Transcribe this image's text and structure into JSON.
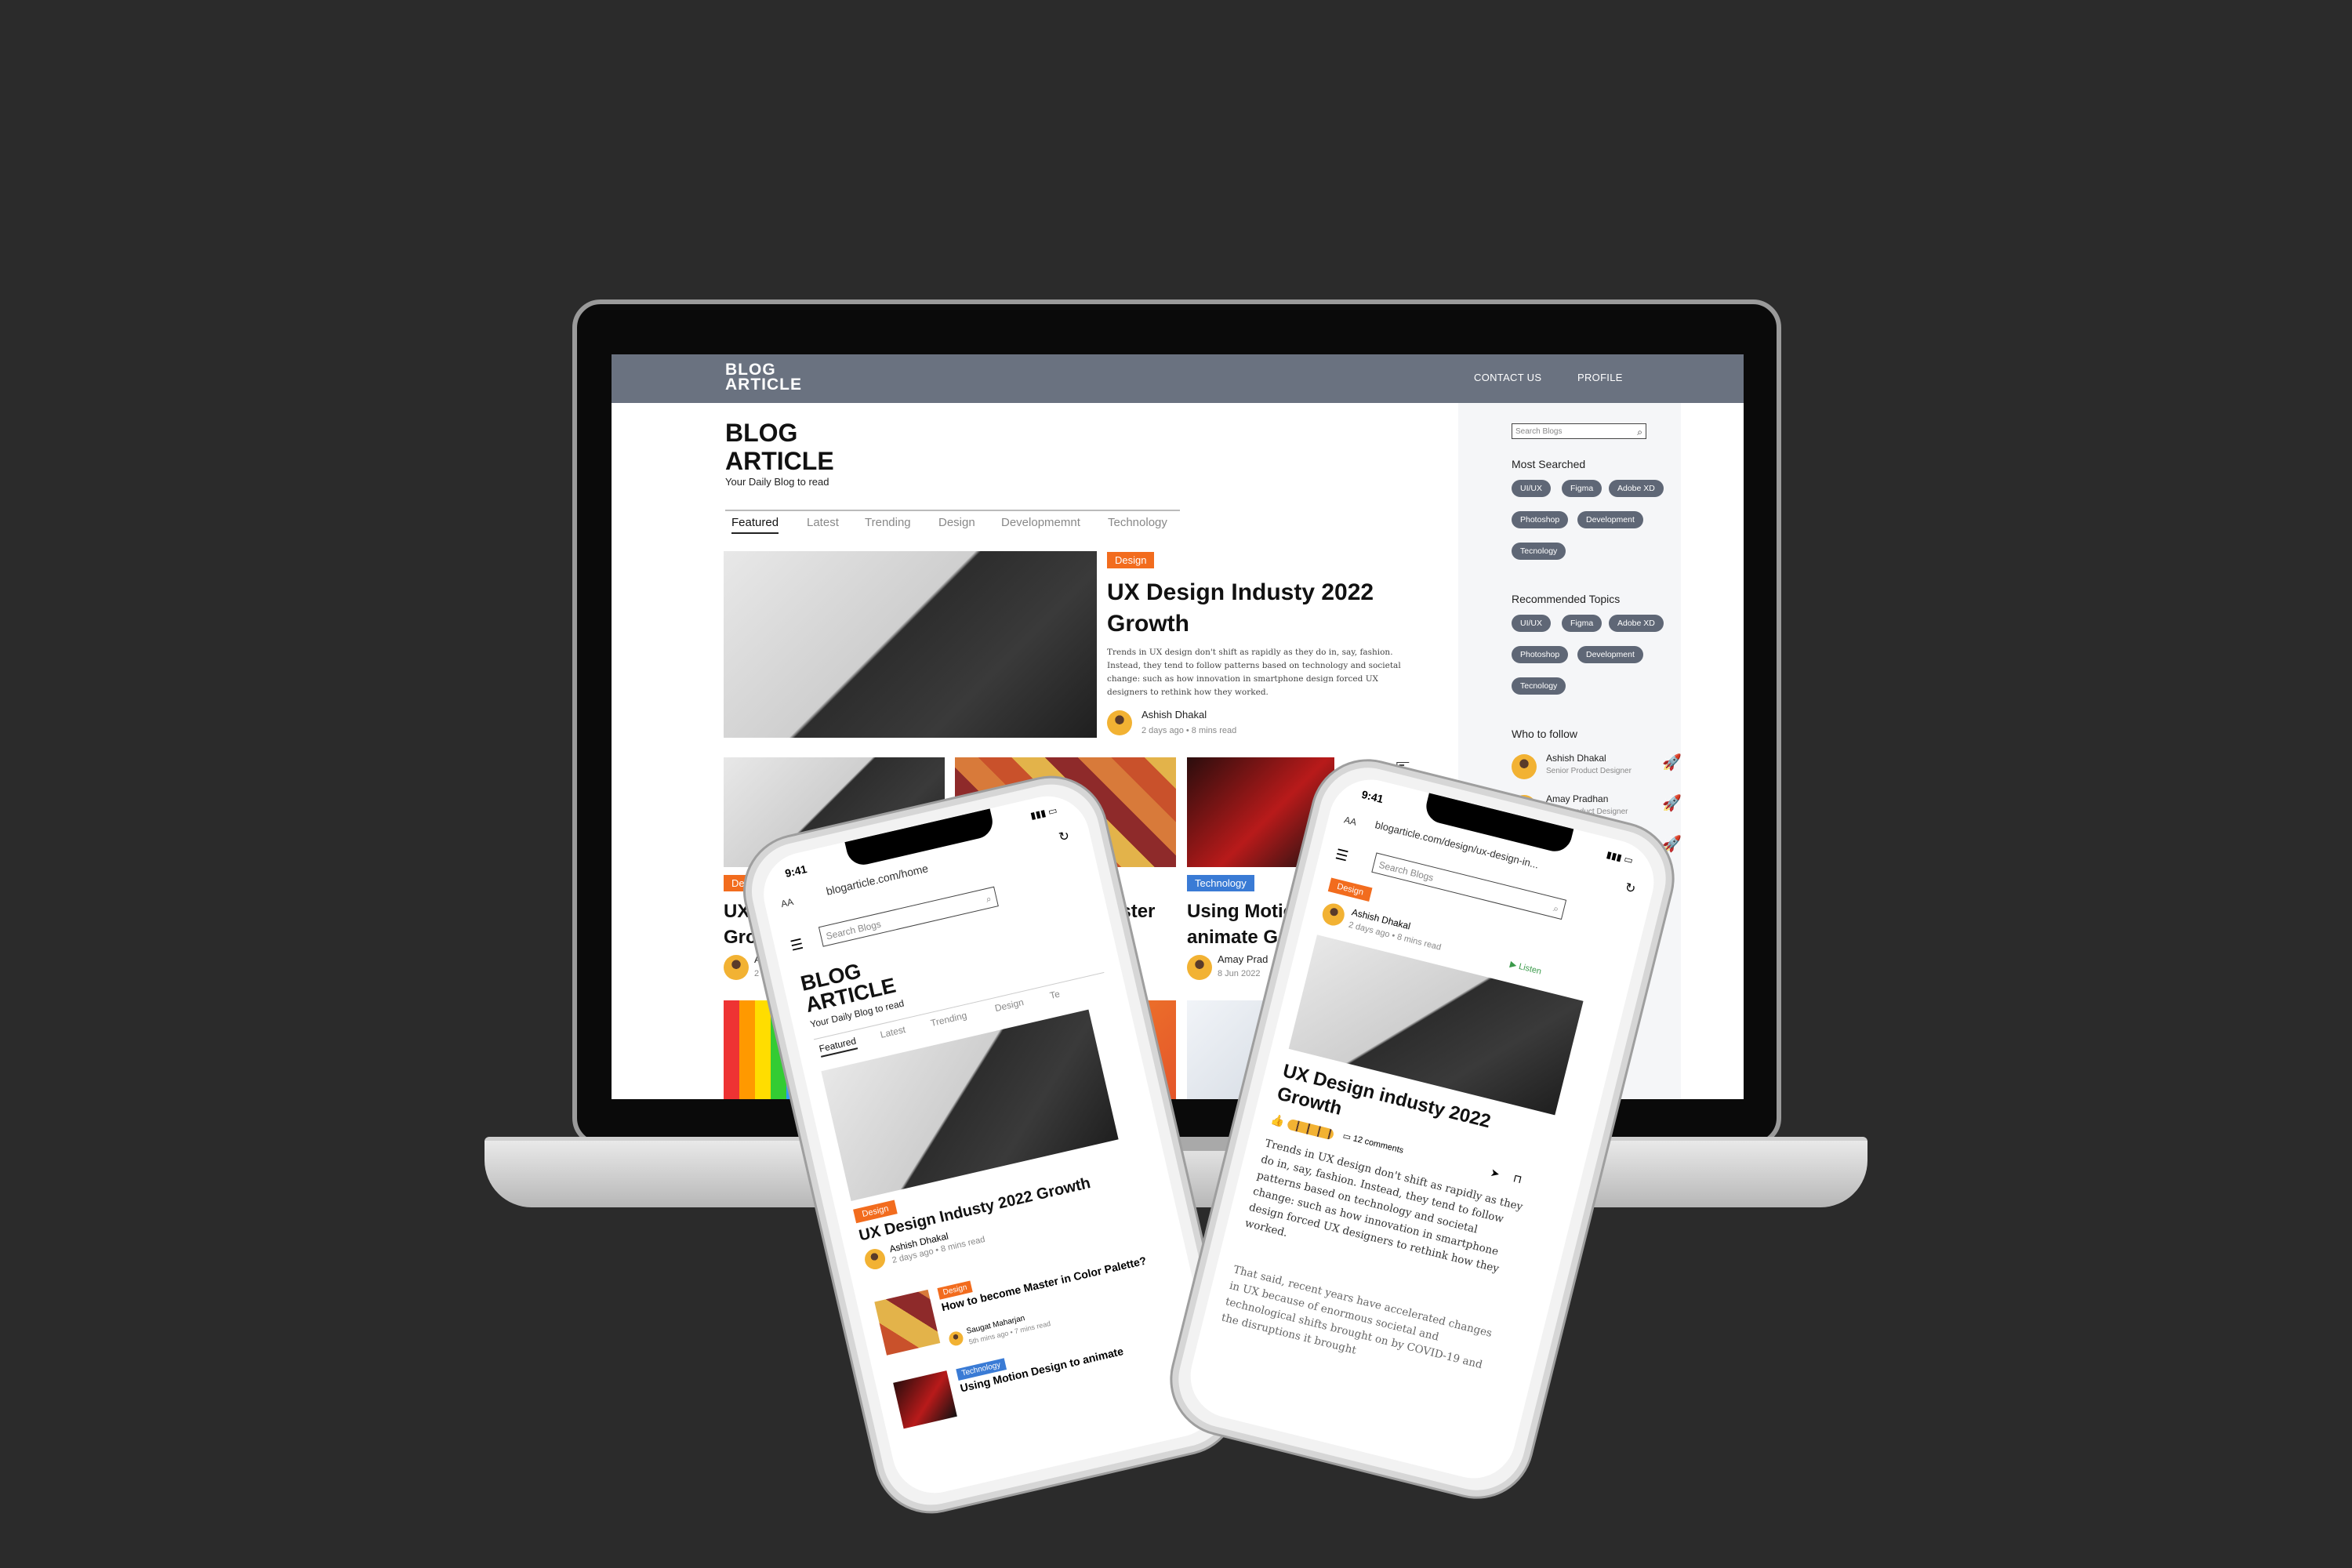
{
  "site": {
    "brand_line1": "BLOG",
    "brand_line2": "ARTICLE",
    "nav": {
      "contact": "CONTACT US",
      "profile": "PROFILE"
    },
    "hero": {
      "title1": "BLOG",
      "title2": "ARTICLE",
      "subtitle": "Your Daily Blog to read"
    },
    "tabs": [
      "Featured",
      "Latest",
      "Trending",
      "Design",
      "Developmemnt",
      "Technology"
    ],
    "featured": {
      "category": "Design",
      "title1": "UX Design Industy 2022",
      "title2": "Growth",
      "body": "Trends in UX design don't shift as rapidly as they do in, say, fashion. Instead, they tend to follow patterns based on technology and societal change: such as how innovation in smartphone design forced UX designers to rethink how they worked.",
      "author": "Ashish Dhakal",
      "meta": "2 days ago    • 8 mins read"
    },
    "cards": [
      {
        "category": "Design",
        "title1": "UX De",
        "title2": "Growth",
        "author": "Ashish",
        "meta": "2 days ag"
      },
      {
        "category": "",
        "title1": "ome Master",
        "title2": "tte?",
        "author": "",
        "meta": "ead"
      },
      {
        "category": "Technology",
        "title1": "Using Motio",
        "title2": "animate G",
        "author": "Amay Prad",
        "meta": "8 Jun 2022"
      }
    ],
    "sidebar": {
      "search_placeholder": "Search Blogs",
      "most_searched_title": "Most Searched",
      "most_searched": [
        "UI/UX",
        "Figma",
        "Adobe XD",
        "Photoshop",
        "Development",
        "Tecnology"
      ],
      "recommended_title": "Recommended Topics",
      "recommended": [
        "UI/UX",
        "Figma",
        "Adobe XD",
        "Photoshop",
        "Development",
        "Tecnology"
      ],
      "follow_title": "Who to follow",
      "follow": [
        {
          "name": "Ashish Dhakal",
          "role": "Senior Product Designer"
        },
        {
          "name": "Amay Pradhan",
          "role": "...iate Product Designer"
        }
      ]
    }
  },
  "phone_left": {
    "time": "9:41",
    "aa": "AA",
    "url": "blogarticle.com/home",
    "search_placeholder": "Search Blogs",
    "title1": "BLOG",
    "title2": "ARTICLE",
    "subtitle": "Your Daily Blog to read",
    "tabs": [
      "Featured",
      "Latest",
      "Trending",
      "Design",
      "Te"
    ],
    "featured": {
      "category": "Design",
      "title": "UX Design Industy 2022 Growth",
      "author": "Ashish Dhakal",
      "meta": "2 days ago    • 8 mins read"
    },
    "item2": {
      "category": "Design",
      "title": "How to become Master in Color Palette?",
      "author": "Saugat Maharjan",
      "meta": "5th mins ago    • 7 mins read"
    },
    "item3": {
      "category": "Technology",
      "title": "Using Motion Design to animate"
    }
  },
  "phone_right": {
    "time": "9:41",
    "aa": "AA",
    "url": "blogarticle.com/design/ux-design-in...",
    "search_placeholder": "Search Blogs",
    "category": "Design",
    "author": "Ashish Dhakal",
    "meta": "2 days ago    • 8 mins read",
    "listen": "Listen",
    "title": "UX Design industy 2022 Growth",
    "comments": "12 comments",
    "para1": "Trends in UX design don't shift as rapidly as they do in, say, fashion. Instead, they tend to follow patterns based on technology and societal change: such as how innovation in smartphone design forced UX designers to rethink how they worked.",
    "para2": "That said, recent years have accelerated changes in UX because of enormous societal and technological shifts brought on by COVID-19 and the disruptions it brought"
  }
}
